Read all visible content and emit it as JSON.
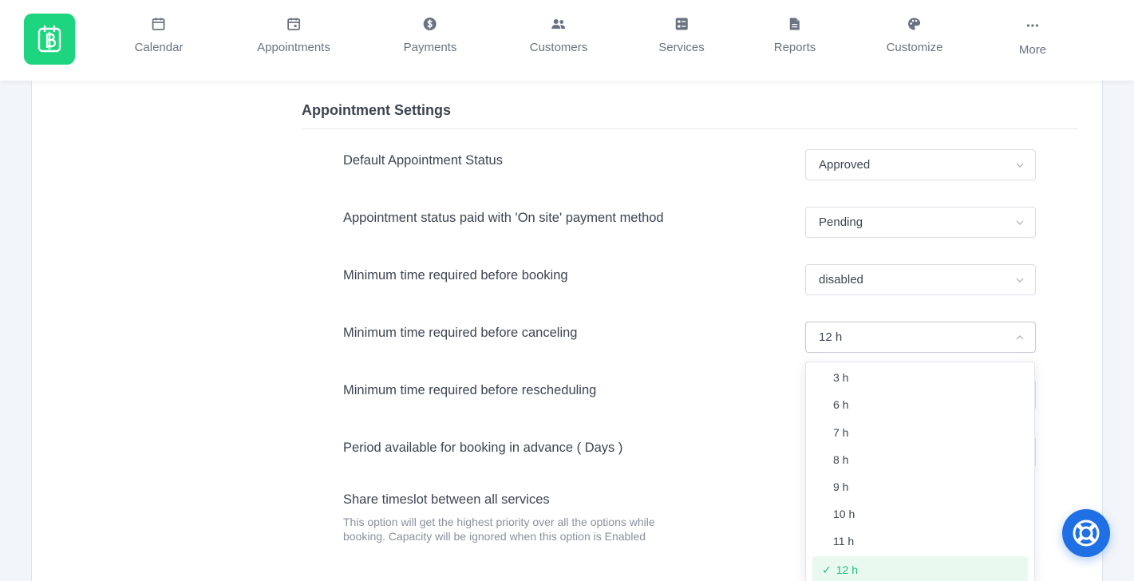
{
  "nav": {
    "items": [
      {
        "label": "Calendar",
        "icon": "calendar-icon"
      },
      {
        "label": "Appointments",
        "icon": "calendar-event-icon"
      },
      {
        "label": "Payments",
        "icon": "dollar-circle-icon"
      },
      {
        "label": "Customers",
        "icon": "users-icon"
      },
      {
        "label": "Services",
        "icon": "list-grid-icon"
      },
      {
        "label": "Reports",
        "icon": "file-icon"
      },
      {
        "label": "Customize",
        "icon": "palette-icon"
      },
      {
        "label": "More",
        "icon": "more-dots-icon"
      }
    ]
  },
  "settings": {
    "title": "Appointment Settings",
    "rows": [
      {
        "label": "Default Appointment Status",
        "value": "Approved"
      },
      {
        "label": "Appointment status paid with 'On site' payment method",
        "value": "Pending"
      },
      {
        "label": "Minimum time required before booking",
        "value": "disabled"
      },
      {
        "label": "Minimum time required before canceling",
        "value": "12 h"
      },
      {
        "label": "Minimum time required before rescheduling",
        "value": ""
      },
      {
        "label": "Period available for booking in advance ( Days )",
        "value": ""
      },
      {
        "label": "Share timeslot between all services",
        "description": "This option will get the highest priority over all the options while booking. Capacity will be ignored when this option is Enabled"
      }
    ]
  },
  "dropdown": {
    "options": [
      "3 h",
      "6 h",
      "7 h",
      "8 h",
      "9 h",
      "10 h",
      "11 h",
      "12 h"
    ],
    "selected": "12 h",
    "selected_mark": "✓"
  },
  "colors": {
    "brand": "#1ed57f",
    "help": "#1f6fe5",
    "selected_bg": "#e9f9f0",
    "selected_text": "#1ec27a"
  }
}
